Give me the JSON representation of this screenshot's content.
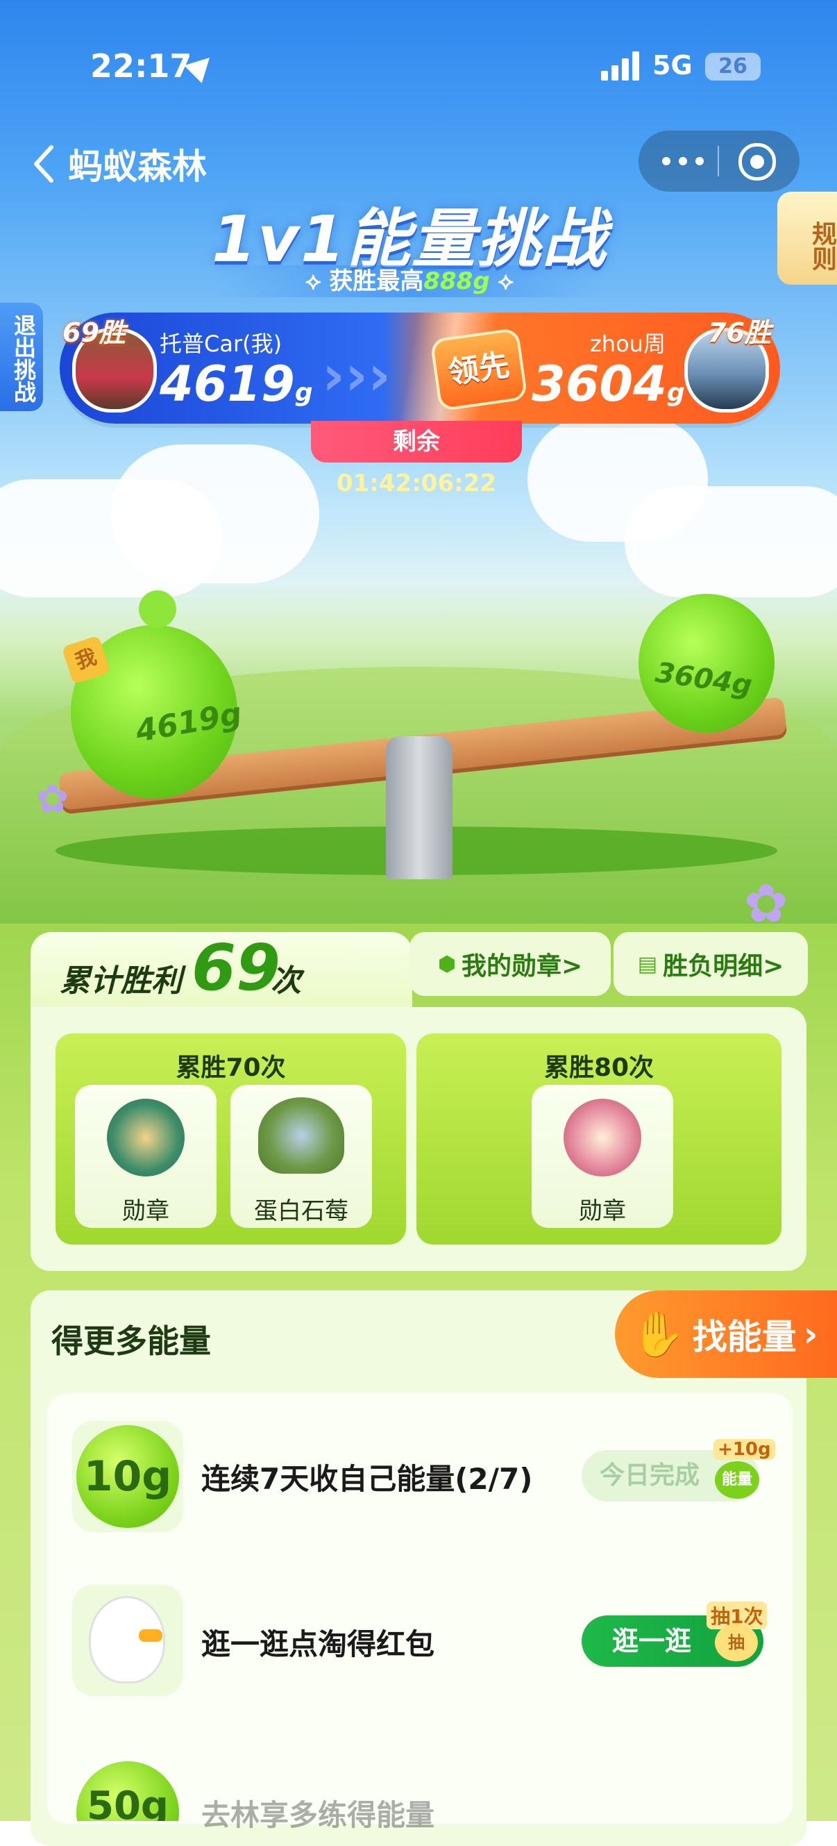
{
  "status_bar": {
    "time": "22:17",
    "network": "5G",
    "battery": "26"
  },
  "nav": {
    "back_title": "蚂蚁森林"
  },
  "banner": {
    "title": "1v1能量挑战",
    "subtitle_prefix": "获胜最高",
    "subtitle_highlight": "888g"
  },
  "side": {
    "rules": "规则",
    "exit": "退出挑战"
  },
  "me": {
    "wins": "69胜",
    "name": "托普Car(我)",
    "score": "4619",
    "unit": "g"
  },
  "opponent": {
    "wins": "76胜",
    "name": "zhou周",
    "score": "3604",
    "unit": "g"
  },
  "lead_badge": "领先",
  "remaining": {
    "label": "剩余",
    "time": "01:42:06:22"
  },
  "scene": {
    "me_tag": "我",
    "me_weight": "4619g",
    "opp_weight": "3604g"
  },
  "wins_section": {
    "prefix": "累计胜利",
    "count": "69",
    "suffix": "次",
    "my_medals": "我的勋章>",
    "record": "胜负明细>",
    "tiers": [
      {
        "title": "累胜70次",
        "rewards": [
          "勋章",
          "蛋白石莓"
        ]
      },
      {
        "title": "累胜80次",
        "rewards": [
          "勋章"
        ]
      }
    ]
  },
  "energy_section": {
    "title": "得更多能量",
    "find_btn": "找能量",
    "tasks": [
      {
        "icon_text": "10g",
        "label": "连续7天收自己能量(2/7)",
        "button": "今日完成",
        "reward": "+10g",
        "reward_chip": "能量"
      },
      {
        "icon_text": "",
        "label": "逛一逛点淘得红包",
        "button": "逛一逛",
        "reward": "抽1次",
        "reward_chip": "抽"
      },
      {
        "icon_text": "50g",
        "label": "去林享多练得能量",
        "button": "",
        "reward": "",
        "reward_chip": ""
      }
    ]
  },
  "colors": {
    "accent_green": "#5cbd12",
    "blue": "#2f6cf3",
    "orange": "#ff6a1e"
  }
}
